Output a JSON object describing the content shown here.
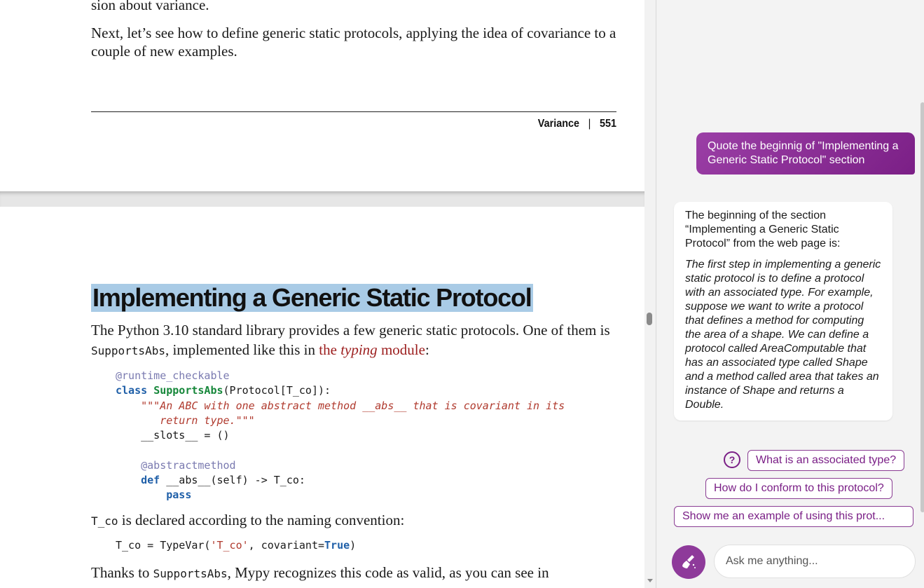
{
  "document": {
    "prev_line": "sion about variance.",
    "next_para": "Next, let’s see how to define generic static protocols, applying the idea of covariance to a couple of new examples.",
    "footer": {
      "section": "Variance",
      "separator": "|",
      "page": "551"
    },
    "heading": "Implementing a Generic Static Protocol",
    "intro": {
      "part1": "The Python 3.10 standard library provides a few generic static protocols. One of them is ",
      "code1": "SupportsAbs",
      "part2": ", implemented like this in ",
      "link_pre": "the ",
      "link_em": "typing",
      "link_post": " module",
      "part3": ":"
    },
    "code": {
      "decorator1": "@runtime_checkable",
      "kw_class": "class",
      "class_name": "SupportsAbs",
      "class_args": "(Protocol[T_co]):",
      "doc_line1": "\"\"\"An ABC with one abstract method __abs__ that is covariant in its",
      "doc_line2": "return type.\"\"\"",
      "slots": "__slots__ = ()",
      "decorator2": "@abstractmethod",
      "kw_def": "def",
      "def_sig": "__abs__(self) -> T_co:",
      "kw_pass": "pass"
    },
    "tco": {
      "code": "T_co",
      "text": " is declared according to the naming convention:"
    },
    "code2": {
      "lhs": "T_co = TypeVar(",
      "str": "'T_co'",
      "mid": ", covariant=",
      "kw_true": "True",
      "end": ")"
    },
    "thanks": {
      "part1": "Thanks to ",
      "code": "SupportsAbs",
      "part2": ", Mypy recognizes this code as valid, as you can see in"
    }
  },
  "chat": {
    "user_message": "Quote the beginnig of \"Implementing a Generic Static Protocol\" section",
    "bot_intro": "The beginning of the section “Implementing a Generic Static Protocol” from the web page is:",
    "bot_quote": "The first step in implementing a generic static protocol is to define a protocol with an associated type. For example, suppose we want to write a protocol that defines a method for computing the area of a shape. We can define a protocol called AreaComputable that has an associated type called Shape and a method called area that takes an instance of Shape and returns a Double.",
    "suggestions": [
      "What is an associated type?",
      "How do I conform to this protocol?",
      "Show me an example of using this prot..."
    ],
    "help_icon_glyph": "?",
    "input_placeholder": "Ask me anything...",
    "accent_color": "#8e3a9a"
  }
}
